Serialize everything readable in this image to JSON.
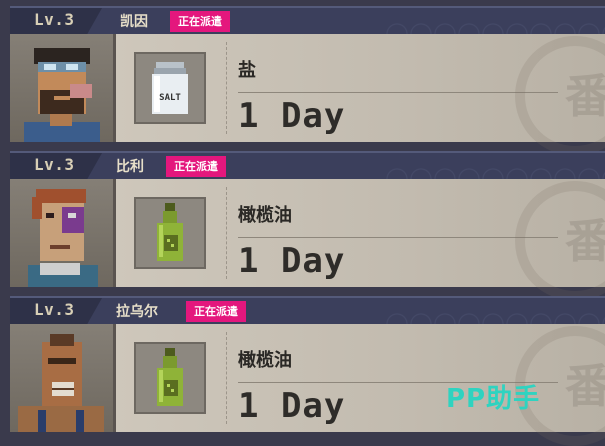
{
  "cards": [
    {
      "level": "Lv.3",
      "name": "凯因",
      "status": "正在派遣",
      "item_icon": "salt-shaker-icon",
      "item_icon_text": "SALT",
      "item_name": "盐",
      "duration": "1 Day"
    },
    {
      "level": "Lv.3",
      "name": "比利",
      "status": "正在派遣",
      "item_icon": "olive-oil-bottle-icon",
      "item_name": "橄榄油",
      "duration": "1 Day"
    },
    {
      "level": "Lv.3",
      "name": "拉乌尔",
      "status": "正在派遣",
      "item_icon": "olive-oil-bottle-icon",
      "item_name": "橄榄油",
      "duration": "1 Day"
    }
  ],
  "watermark": "PP助手",
  "colors": {
    "header": "#3b3f5c",
    "badge": "#e4177d",
    "card_body": "#c3bcb0",
    "watermark": "#2fd3c0"
  }
}
